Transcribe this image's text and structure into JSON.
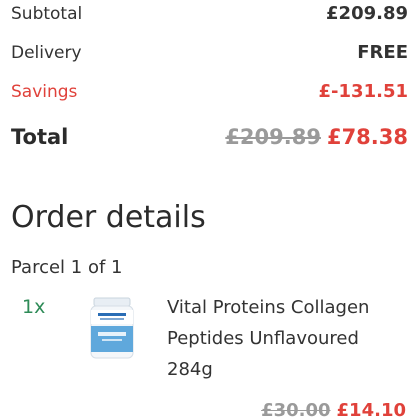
{
  "summary": {
    "subtotal": {
      "label": "Subtotal",
      "value": "£209.89"
    },
    "delivery": {
      "label": "Delivery",
      "value": "FREE"
    },
    "savings": {
      "label": "Savings",
      "value": "£-131.51"
    },
    "total": {
      "label": "Total",
      "original": "£209.89",
      "price": "£78.38"
    }
  },
  "order": {
    "title": "Order details",
    "parcel": "Parcel 1 of 1",
    "items": [
      {
        "qty": "1x",
        "name": "Vital Proteins Collagen Peptides Unflavoured 284g",
        "original_price": "£30.00",
        "price": "£14.10"
      }
    ]
  },
  "colors": {
    "accent_red": "#e0413a",
    "qty_green": "#2e8b57",
    "muted_grey": "#9a9a9a"
  }
}
